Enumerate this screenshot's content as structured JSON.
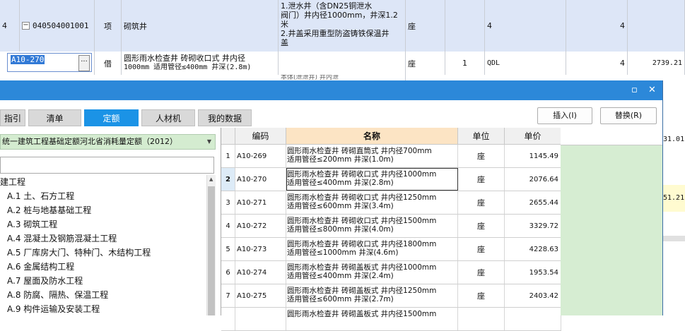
{
  "background_sheet": {
    "row1": {
      "index": "4",
      "code": "040504001001",
      "type": "项",
      "name": "砌筑井",
      "desc_line1": "1.泄水井（含DN25铜泄水",
      "desc_line2": "阀门）井内径1000mm，井深1.2",
      "desc_line3": "米",
      "desc_line4": "2.井盖采用重型防盗铸铁保温井",
      "desc_line5": "盖",
      "unit": "座",
      "qty_expr": "4",
      "qty": "4"
    },
    "row2": {
      "code_value": "A10-270",
      "type": "借",
      "name_line1": "圆形雨水检查井 砖砌收口式 井内径",
      "name_line2": "1000mm 适用管径≤400mm 井深(2.8m)",
      "unit": "座",
      "coef": "1",
      "qty_expr": "QDL",
      "qty": "4",
      "price": "2739.21"
    },
    "row3_partial": "本体(泄泄井) 井内泄",
    "right_edge_values": [
      "31.01",
      "51.21"
    ]
  },
  "dialog": {
    "tabs": [
      {
        "label": "指引",
        "active": false
      },
      {
        "label": "清单",
        "active": false
      },
      {
        "label": "定额",
        "active": true
      },
      {
        "label": "人材机",
        "active": false
      },
      {
        "label": "我的数据",
        "active": false
      }
    ],
    "insert_label": "插入(I)",
    "replace_label": "替换(R)",
    "library_name": "统一建筑工程基础定额河北省消耗量定额（2012）",
    "search_value": "",
    "tree_root": "建工程",
    "tree_items": [
      "A.1 土、石方工程",
      "A.2 桩与地基基础工程",
      "A.3 砌筑工程",
      "A.4 混凝土及钢筋混凝土工程",
      "A.5 厂库房大门、特种门、木结构工程",
      "A.6 金属结构工程",
      "A.7 屋面及防水工程",
      "A.8 防腐、隔热、保温工程",
      "A.9 构件运输及安装工程"
    ],
    "grid": {
      "headers": {
        "code": "编码",
        "name": "名称",
        "unit": "单位",
        "price": "单价"
      },
      "rows": [
        {
          "num": "1",
          "code": "A10-269",
          "name1": "圆形雨水检查井 砖砌直筒式 井内径700mm",
          "name2": "适用管径≤200mm 井深(1.0m)",
          "unit": "座",
          "price": "1145.49"
        },
        {
          "num": "2",
          "code": "A10-270",
          "name1": "圆形雨水检查井 砖砌收口式 井内径1000mm",
          "name2": "适用管径≤400mm 井深(2.8m)",
          "unit": "座",
          "price": "2076.64"
        },
        {
          "num": "3",
          "code": "A10-271",
          "name1": "圆形雨水检查井 砖砌收口式 井内径1250mm",
          "name2": "适用管径≤600mm 井深(3.4m)",
          "unit": "座",
          "price": "2655.44"
        },
        {
          "num": "4",
          "code": "A10-272",
          "name1": "圆形雨水检查井 砖砌收口式 井内径1500mm",
          "name2": "适用管径≤800mm 井深(4.0m)",
          "unit": "座",
          "price": "3329.72"
        },
        {
          "num": "5",
          "code": "A10-273",
          "name1": "圆形雨水检查井 砖砌收口式 井内径1800mm",
          "name2": "适用管径≤1000mm 井深(4.6m)",
          "unit": "座",
          "price": "4228.63"
        },
        {
          "num": "6",
          "code": "A10-274",
          "name1": "圆形雨水检查井 砖砌盖板式 井内径1000mm",
          "name2": "适用管径≤400mm 井深(2.4m)",
          "unit": "座",
          "price": "1953.54"
        },
        {
          "num": "7",
          "code": "A10-275",
          "name1": "圆形雨水检查井 砖砌盖板式 井内径1250mm",
          "name2": "适用管径≤600mm 井深(2.7m)",
          "unit": "座",
          "price": "2403.42"
        },
        {
          "num": "",
          "code": "",
          "name1": "圆形雨水检查井 砖砌盖板式 井内径1500mm",
          "name2": "",
          "unit": "",
          "price": ""
        }
      ]
    }
  }
}
